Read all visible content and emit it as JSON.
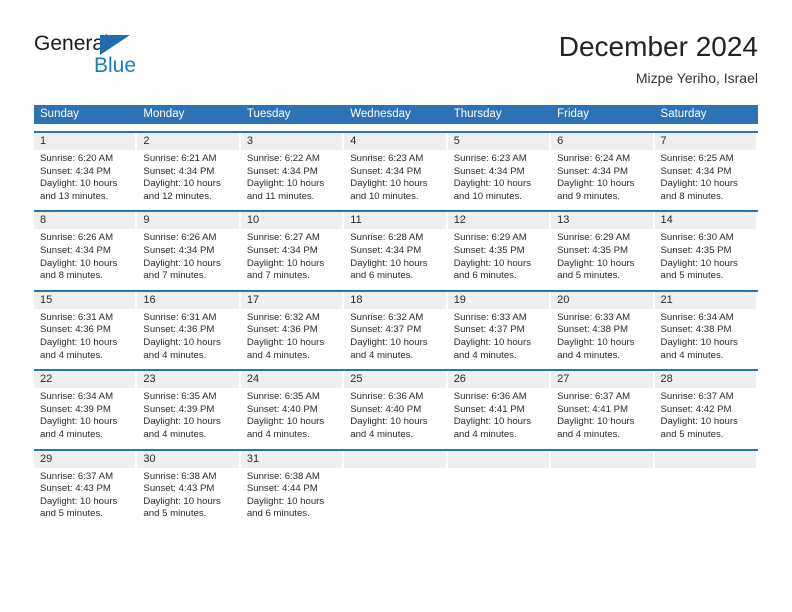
{
  "brand": {
    "name_part1": "General",
    "name_part2": "Blue",
    "triangle_color": "#1f6cb0",
    "blue_color": "#1f7ac0"
  },
  "header": {
    "title": "December 2024",
    "subtitle": "Mizpe Yeriho, Israel"
  },
  "theme": {
    "header_blue": "#2d72b4",
    "day_band_gray": "#efefef",
    "text": "#2b2b2b"
  },
  "weekdays": [
    "Sunday",
    "Monday",
    "Tuesday",
    "Wednesday",
    "Thursday",
    "Friday",
    "Saturday"
  ],
  "labels": {
    "sunrise_prefix": "Sunrise:",
    "sunset_prefix": "Sunset:",
    "daylight_prefix": "Daylight:"
  },
  "weeks": [
    [
      {
        "day": "1",
        "sunrise": "Sunrise: 6:20 AM",
        "sunset": "Sunset: 4:34 PM",
        "daylight1": "Daylight: 10 hours",
        "daylight2": "and 13 minutes."
      },
      {
        "day": "2",
        "sunrise": "Sunrise: 6:21 AM",
        "sunset": "Sunset: 4:34 PM",
        "daylight1": "Daylight: 10 hours",
        "daylight2": "and 12 minutes."
      },
      {
        "day": "3",
        "sunrise": "Sunrise: 6:22 AM",
        "sunset": "Sunset: 4:34 PM",
        "daylight1": "Daylight: 10 hours",
        "daylight2": "and 11 minutes."
      },
      {
        "day": "4",
        "sunrise": "Sunrise: 6:23 AM",
        "sunset": "Sunset: 4:34 PM",
        "daylight1": "Daylight: 10 hours",
        "daylight2": "and 10 minutes."
      },
      {
        "day": "5",
        "sunrise": "Sunrise: 6:23 AM",
        "sunset": "Sunset: 4:34 PM",
        "daylight1": "Daylight: 10 hours",
        "daylight2": "and 10 minutes."
      },
      {
        "day": "6",
        "sunrise": "Sunrise: 6:24 AM",
        "sunset": "Sunset: 4:34 PM",
        "daylight1": "Daylight: 10 hours",
        "daylight2": "and 9 minutes."
      },
      {
        "day": "7",
        "sunrise": "Sunrise: 6:25 AM",
        "sunset": "Sunset: 4:34 PM",
        "daylight1": "Daylight: 10 hours",
        "daylight2": "and 8 minutes."
      }
    ],
    [
      {
        "day": "8",
        "sunrise": "Sunrise: 6:26 AM",
        "sunset": "Sunset: 4:34 PM",
        "daylight1": "Daylight: 10 hours",
        "daylight2": "and 8 minutes."
      },
      {
        "day": "9",
        "sunrise": "Sunrise: 6:26 AM",
        "sunset": "Sunset: 4:34 PM",
        "daylight1": "Daylight: 10 hours",
        "daylight2": "and 7 minutes."
      },
      {
        "day": "10",
        "sunrise": "Sunrise: 6:27 AM",
        "sunset": "Sunset: 4:34 PM",
        "daylight1": "Daylight: 10 hours",
        "daylight2": "and 7 minutes."
      },
      {
        "day": "11",
        "sunrise": "Sunrise: 6:28 AM",
        "sunset": "Sunset: 4:34 PM",
        "daylight1": "Daylight: 10 hours",
        "daylight2": "and 6 minutes."
      },
      {
        "day": "12",
        "sunrise": "Sunrise: 6:29 AM",
        "sunset": "Sunset: 4:35 PM",
        "daylight1": "Daylight: 10 hours",
        "daylight2": "and 6 minutes."
      },
      {
        "day": "13",
        "sunrise": "Sunrise: 6:29 AM",
        "sunset": "Sunset: 4:35 PM",
        "daylight1": "Daylight: 10 hours",
        "daylight2": "and 5 minutes."
      },
      {
        "day": "14",
        "sunrise": "Sunrise: 6:30 AM",
        "sunset": "Sunset: 4:35 PM",
        "daylight1": "Daylight: 10 hours",
        "daylight2": "and 5 minutes."
      }
    ],
    [
      {
        "day": "15",
        "sunrise": "Sunrise: 6:31 AM",
        "sunset": "Sunset: 4:36 PM",
        "daylight1": "Daylight: 10 hours",
        "daylight2": "and 4 minutes."
      },
      {
        "day": "16",
        "sunrise": "Sunrise: 6:31 AM",
        "sunset": "Sunset: 4:36 PM",
        "daylight1": "Daylight: 10 hours",
        "daylight2": "and 4 minutes."
      },
      {
        "day": "17",
        "sunrise": "Sunrise: 6:32 AM",
        "sunset": "Sunset: 4:36 PM",
        "daylight1": "Daylight: 10 hours",
        "daylight2": "and 4 minutes."
      },
      {
        "day": "18",
        "sunrise": "Sunrise: 6:32 AM",
        "sunset": "Sunset: 4:37 PM",
        "daylight1": "Daylight: 10 hours",
        "daylight2": "and 4 minutes."
      },
      {
        "day": "19",
        "sunrise": "Sunrise: 6:33 AM",
        "sunset": "Sunset: 4:37 PM",
        "daylight1": "Daylight: 10 hours",
        "daylight2": "and 4 minutes."
      },
      {
        "day": "20",
        "sunrise": "Sunrise: 6:33 AM",
        "sunset": "Sunset: 4:38 PM",
        "daylight1": "Daylight: 10 hours",
        "daylight2": "and 4 minutes."
      },
      {
        "day": "21",
        "sunrise": "Sunrise: 6:34 AM",
        "sunset": "Sunset: 4:38 PM",
        "daylight1": "Daylight: 10 hours",
        "daylight2": "and 4 minutes."
      }
    ],
    [
      {
        "day": "22",
        "sunrise": "Sunrise: 6:34 AM",
        "sunset": "Sunset: 4:39 PM",
        "daylight1": "Daylight: 10 hours",
        "daylight2": "and 4 minutes."
      },
      {
        "day": "23",
        "sunrise": "Sunrise: 6:35 AM",
        "sunset": "Sunset: 4:39 PM",
        "daylight1": "Daylight: 10 hours",
        "daylight2": "and 4 minutes."
      },
      {
        "day": "24",
        "sunrise": "Sunrise: 6:35 AM",
        "sunset": "Sunset: 4:40 PM",
        "daylight1": "Daylight: 10 hours",
        "daylight2": "and 4 minutes."
      },
      {
        "day": "25",
        "sunrise": "Sunrise: 6:36 AM",
        "sunset": "Sunset: 4:40 PM",
        "daylight1": "Daylight: 10 hours",
        "daylight2": "and 4 minutes."
      },
      {
        "day": "26",
        "sunrise": "Sunrise: 6:36 AM",
        "sunset": "Sunset: 4:41 PM",
        "daylight1": "Daylight: 10 hours",
        "daylight2": "and 4 minutes."
      },
      {
        "day": "27",
        "sunrise": "Sunrise: 6:37 AM",
        "sunset": "Sunset: 4:41 PM",
        "daylight1": "Daylight: 10 hours",
        "daylight2": "and 4 minutes."
      },
      {
        "day": "28",
        "sunrise": "Sunrise: 6:37 AM",
        "sunset": "Sunset: 4:42 PM",
        "daylight1": "Daylight: 10 hours",
        "daylight2": "and 5 minutes."
      }
    ],
    [
      {
        "day": "29",
        "sunrise": "Sunrise: 6:37 AM",
        "sunset": "Sunset: 4:43 PM",
        "daylight1": "Daylight: 10 hours",
        "daylight2": "and 5 minutes."
      },
      {
        "day": "30",
        "sunrise": "Sunrise: 6:38 AM",
        "sunset": "Sunset: 4:43 PM",
        "daylight1": "Daylight: 10 hours",
        "daylight2": "and 5 minutes."
      },
      {
        "day": "31",
        "sunrise": "Sunrise: 6:38 AM",
        "sunset": "Sunset: 4:44 PM",
        "daylight1": "Daylight: 10 hours",
        "daylight2": "and 6 minutes."
      },
      {
        "day": "",
        "sunrise": "",
        "sunset": "",
        "daylight1": "",
        "daylight2": ""
      },
      {
        "day": "",
        "sunrise": "",
        "sunset": "",
        "daylight1": "",
        "daylight2": ""
      },
      {
        "day": "",
        "sunrise": "",
        "sunset": "",
        "daylight1": "",
        "daylight2": ""
      },
      {
        "day": "",
        "sunrise": "",
        "sunset": "",
        "daylight1": "",
        "daylight2": ""
      }
    ]
  ]
}
